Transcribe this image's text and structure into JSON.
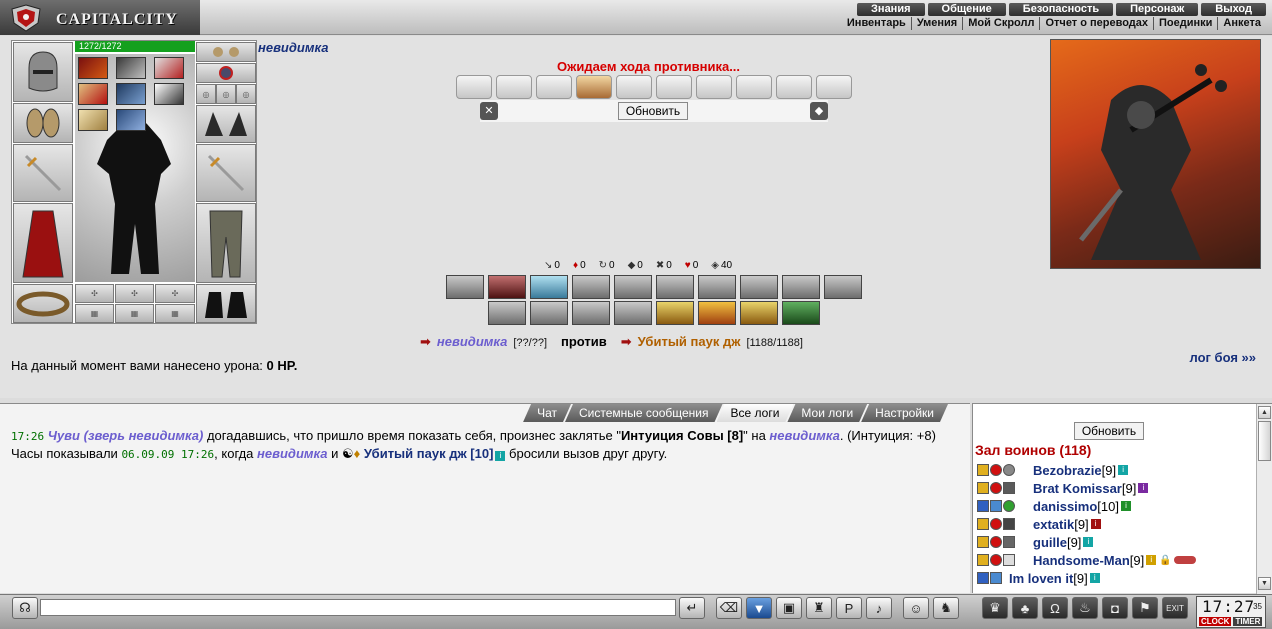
{
  "header": {
    "logo_text": "CAPITALCITY",
    "menu_top": [
      "Знания",
      "Общение",
      "Безопасность",
      "Персонаж",
      "Выход"
    ],
    "menu_sub": [
      "Инвентарь",
      "Умения",
      "Мой Скролл",
      "Отчет о переводах",
      "Поединки",
      "Анкета"
    ]
  },
  "character": {
    "nick": "невидимка",
    "hp": "1272/1272"
  },
  "battle": {
    "status_text": "Ожидаем хода противника...",
    "refresh_label": "Обновить",
    "stats": [
      {
        "icon": "sword-stat-icon",
        "glyph": "↘",
        "value": "0"
      },
      {
        "icon": "blood-stat-icon",
        "glyph": "♦",
        "value": "0"
      },
      {
        "icon": "counter-stat-icon",
        "glyph": "↻",
        "value": "0"
      },
      {
        "icon": "shield-stat-icon",
        "glyph": "◆",
        "value": "0"
      },
      {
        "icon": "crit-stat-icon",
        "glyph": "✖",
        "value": "0"
      },
      {
        "icon": "heart-stat-icon",
        "glyph": "♥",
        "value": "0"
      },
      {
        "icon": "defense-stat-icon",
        "glyph": "◈",
        "value": "40"
      }
    ],
    "fighter_left": "невидимка",
    "fighter_left_hp": "[??/??]",
    "vs_word": "против",
    "fighter_right": "Убитый паук дж",
    "fighter_right_hp": "[1188/1188]",
    "damage_label": "На данный момент вами нанесено урона:",
    "damage_value": "0 HP.",
    "battle_log_link": "лог боя »»"
  },
  "chat": {
    "tabs": [
      "Чат",
      "Системные сообщения",
      "Все логи",
      "Мои логи",
      "Настройки"
    ],
    "active_tab": "Все логи",
    "line1": {
      "time": "17:26",
      "actor": "Чуви (зверь невидимка)",
      "text1": " догадавшись, что пришло время показать себя, произнес заклятье \"",
      "spell": "Интуиция Совы [8]",
      "text2": "\" на ",
      "target": "невидимка",
      "text3": ". (Интуиция: +8)"
    },
    "line2": {
      "prefix": "Часы показывали ",
      "datetime": "06.09.09 17:26",
      "middle": ", когда ",
      "player": "невидимка",
      "and": " и ",
      "opponent": "Убитый паук дж [10]",
      "suffix": " бросили вызов друг другу."
    }
  },
  "players": {
    "refresh_label": "Обновить",
    "title": "Зал воинов (118)",
    "list": [
      {
        "name": "Bezobrazie",
        "level": "[9]"
      },
      {
        "name": "Brat Komissar",
        "level": "[9]"
      },
      {
        "name": "danissimo",
        "level": "[10]"
      },
      {
        "name": "extatik",
        "level": "[9]"
      },
      {
        "name": "guille",
        "level": "[9]"
      },
      {
        "name": "Handsome-Man",
        "level": "[9]"
      },
      {
        "name": "Im loven it",
        "level": "[9]"
      }
    ]
  },
  "clock": {
    "time": "17:27",
    "seconds": "35",
    "label_clock": "CLOCK",
    "label_timer": "TIMER"
  }
}
